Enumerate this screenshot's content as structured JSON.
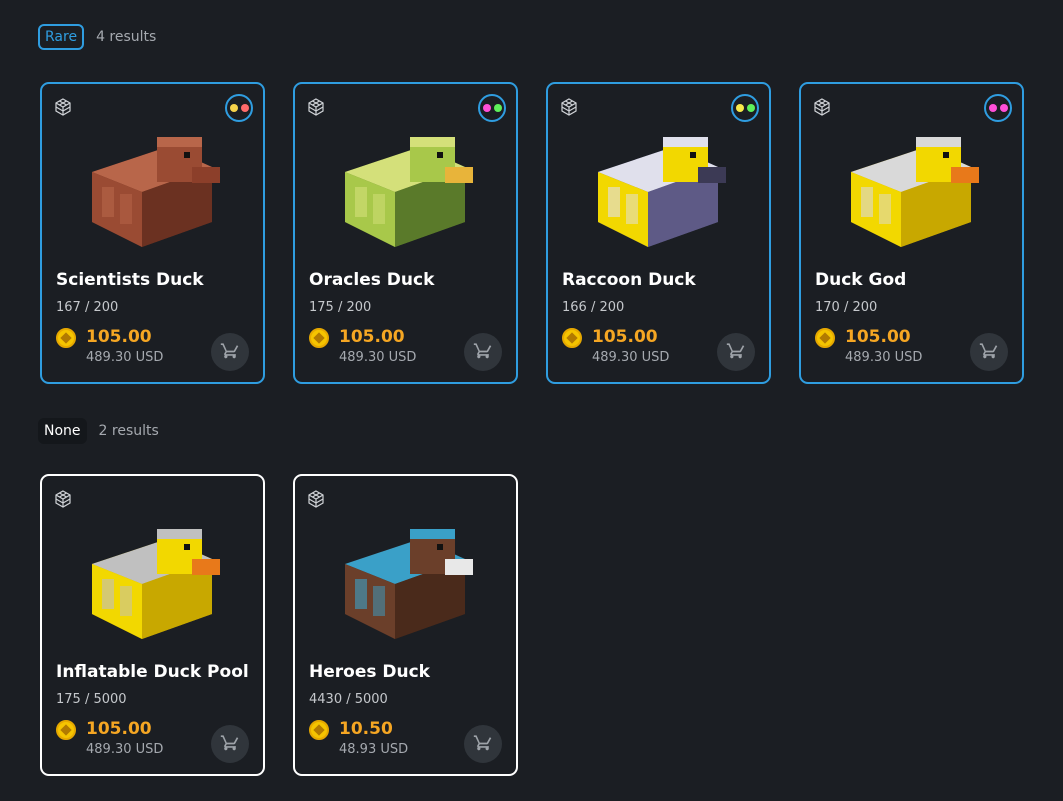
{
  "sections": [
    {
      "tag": "Rare",
      "count": "4 results",
      "items": [
        {
          "name": "Scientists Duck",
          "supply": "167 / 200",
          "price": "105.00",
          "usd": "489.30 USD",
          "dots": [
            "#f7d34a",
            "#ff6b6b"
          ],
          "palette": {
            "body": "#9a4b33",
            "dark": "#6b3121",
            "light": "#b8664a",
            "beak": "#8c3f2a"
          }
        },
        {
          "name": "Oracles Duck",
          "supply": "175 / 200",
          "price": "105.00",
          "usd": "489.30 USD",
          "dots": [
            "#ff4fd8",
            "#5ef05a"
          ],
          "palette": {
            "body": "#a8c84a",
            "dark": "#5b7a2a",
            "light": "#d4e07a",
            "beak": "#e8b43a"
          }
        },
        {
          "name": "Raccoon Duck",
          "supply": "166 / 200",
          "price": "105.00",
          "usd": "489.30 USD",
          "dots": [
            "#f7e94a",
            "#5ef05a"
          ],
          "palette": {
            "body": "#f2d800",
            "dark": "#5e5a86",
            "light": "#e0e0ec",
            "beak": "#3c3a55"
          }
        },
        {
          "name": "Duck God",
          "supply": "170 / 200",
          "price": "105.00",
          "usd": "489.30 USD",
          "dots": [
            "#ff4fd8",
            "#ff4fd8"
          ],
          "palette": {
            "body": "#f2d800",
            "dark": "#c8a800",
            "light": "#d9d9d9",
            "beak": "#e8791a"
          }
        }
      ]
    },
    {
      "tag": "None",
      "count": "2 results",
      "items": [
        {
          "name": "Inflatable Duck Pool",
          "supply": "175 / 5000",
          "price": "105.00",
          "usd": "489.30 USD",
          "dots": [],
          "palette": {
            "body": "#f2d800",
            "dark": "#c8a800",
            "light": "#c0c0c0",
            "beak": "#e8791a"
          }
        },
        {
          "name": "Heroes Duck",
          "supply": "4430 / 5000",
          "price": "10.50",
          "usd": "48.93 USD",
          "dots": [],
          "palette": {
            "body": "#6b3f2a",
            "dark": "#4a2a1b",
            "light": "#3aa0c8",
            "beak": "#e8e8e8"
          }
        }
      ]
    }
  ],
  "colors": {
    "accent": "#2f9de0",
    "price": "#f5a623",
    "background": "#1b1e23"
  },
  "icons": {
    "model": "cube-icon",
    "buy": "cart-icon",
    "currency": "coin-icon"
  }
}
